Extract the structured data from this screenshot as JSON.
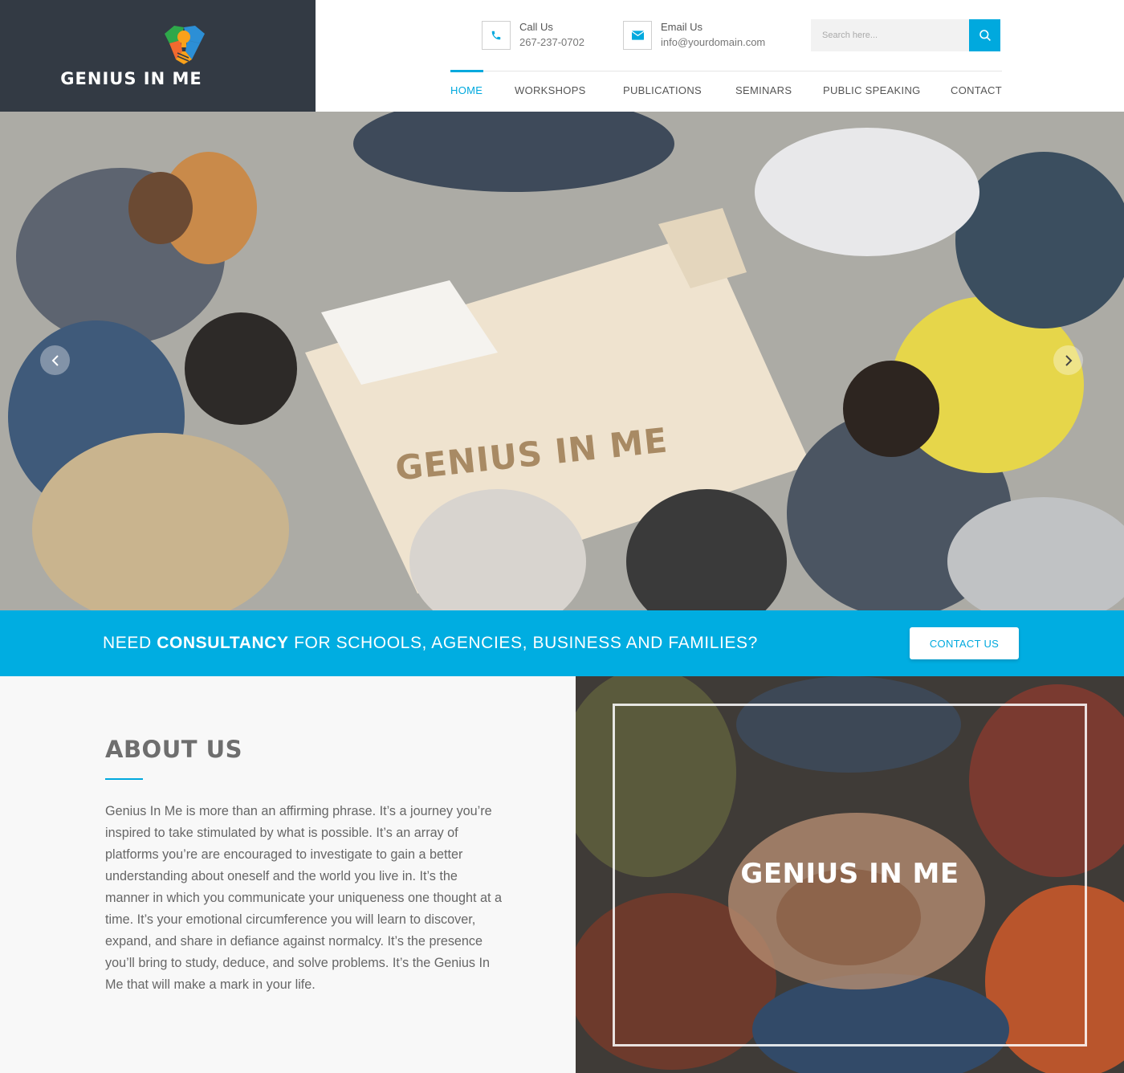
{
  "brand": {
    "name": "GENIUS IN ME",
    "colors": {
      "accent": "#00a9de",
      "header_dark": "#333a44",
      "banner": "#00ade1"
    }
  },
  "header": {
    "call": {
      "title": "Call Us",
      "value": "267-237-0702",
      "icon": "phone-icon"
    },
    "email": {
      "title": "Email Us",
      "value": "info@yourdomain.com",
      "icon": "envelope-icon"
    },
    "search": {
      "placeholder": "Search here...",
      "icon": "search-icon"
    }
  },
  "nav": {
    "items": [
      {
        "label": "HOME",
        "active": true
      },
      {
        "label": "WORKSHOPS",
        "active": false
      },
      {
        "label": "PUBLICATIONS",
        "active": false
      },
      {
        "label": "SEMINARS",
        "active": false
      },
      {
        "label": "PUBLIC SPEAKING",
        "active": false
      },
      {
        "label": "CONTACT",
        "active": false
      }
    ]
  },
  "hero": {
    "title": "GENIUS IN ME",
    "prev_icon": "chevron-left-icon",
    "next_icon": "chevron-right-icon"
  },
  "banner": {
    "text_before": "NEED ",
    "text_bold": "CONSULTANCY",
    "text_after": " FOR SCHOOLS, AGENCIES, BUSINESS AND FAMILIES?",
    "button_label": "CONTACT US"
  },
  "about": {
    "title": "ABOUT US",
    "body": "Genius In Me is more than an affirming phrase. It’s a journey you’re inspired to take stimulated by what is possible. It’s an array of platforms you’re are encouraged to investigate to gain a better understanding about oneself and the world you live in. It’s the manner in which you communicate your uniqueness one thought at a time. It’s your emotional circumference you will learn to discover, expand, and share in defiance against normalcy. It’s the presence you’ll bring to study, deduce, and solve problems. It’s the Genius In Me that will make a mark in your life."
  },
  "team": {
    "title": "GENIUS IN ME"
  }
}
